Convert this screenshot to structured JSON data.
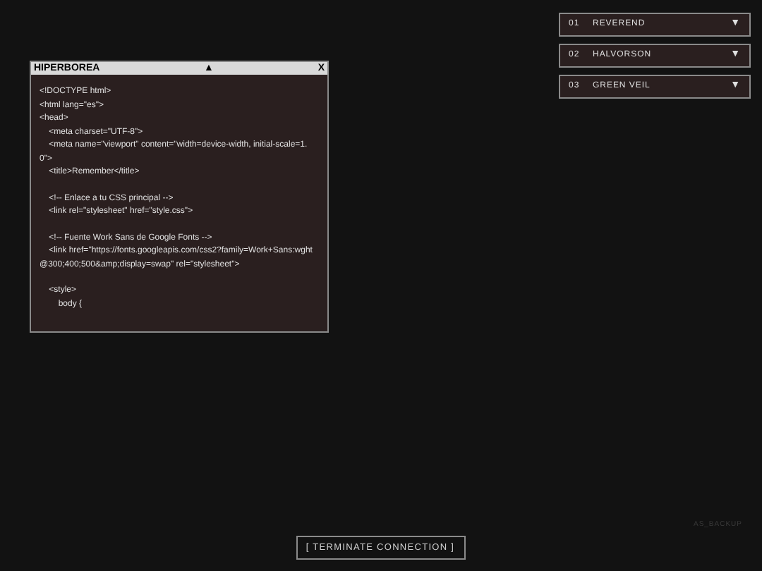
{
  "window": {
    "title": "HIPERBOREA",
    "collapse_glyph": "▲",
    "close_glyph": "X",
    "code_blocks": [
      [
        "<!DOCTYPE html>",
        "<html lang=\"es\">",
        "<head>",
        "    <meta charset=\"UTF-8\">",
        "    <meta name=\"viewport\" content=\"width=device-width, initial-scale=1.0\">",
        "    <title>Remember</title>"
      ],
      [
        "    <!-- Enlace a tu CSS principal -->",
        "    <link rel=\"stylesheet\" href=\"style.css\">"
      ],
      [
        "    <!-- Fuente Work Sans de Google Fonts -->",
        "    <link href=\"https://fonts.googleapis.com/css2?family=Work+Sans:wght@300;400;500&amp;display=swap\" rel=\"stylesheet\">"
      ],
      [
        "    <style>",
        "        body {"
      ]
    ]
  },
  "dropdowns": [
    {
      "number": "01",
      "label": "REVEREND",
      "caret": "▼"
    },
    {
      "number": "02",
      "label": "HALVORSON",
      "caret": "▼"
    },
    {
      "number": "03",
      "label": "GREEN VEIL",
      "caret": "▼"
    }
  ],
  "footer_label": "AS_BACKUP",
  "terminate_button": "[ TERMINATE CONNECTION ]"
}
